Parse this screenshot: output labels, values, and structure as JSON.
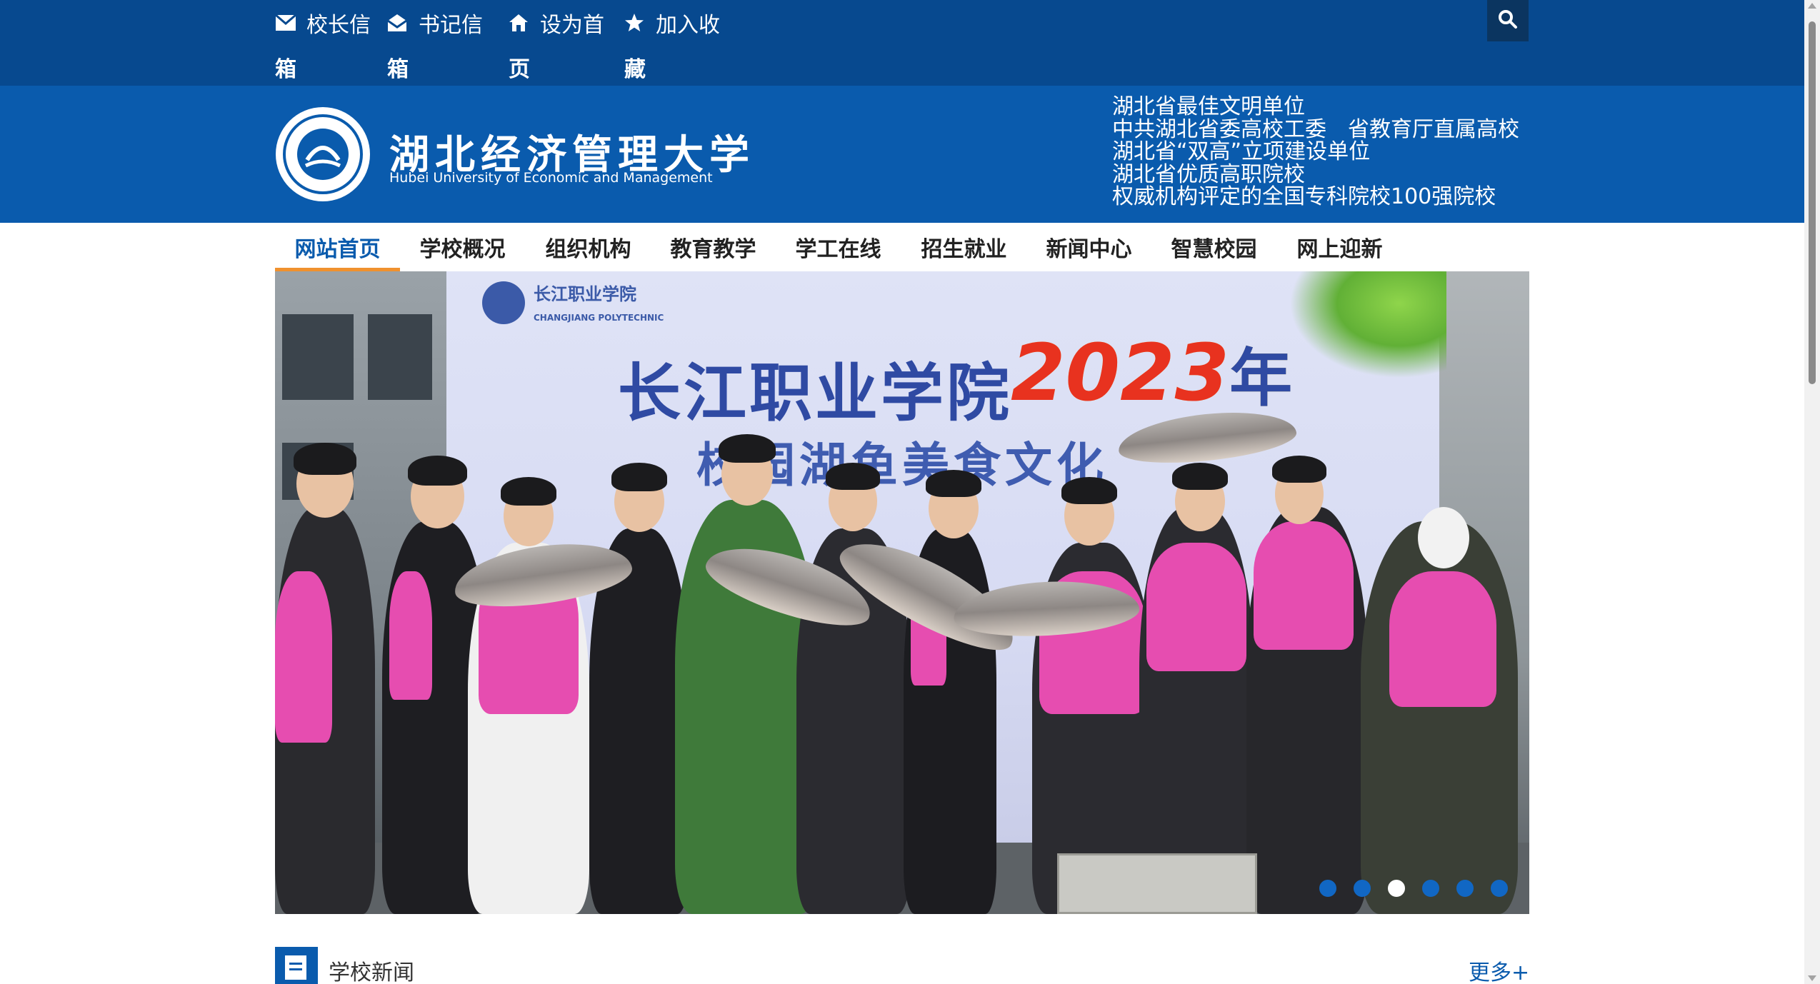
{
  "topbar": {
    "links": [
      {
        "label": "校长信",
        "wrap": "箱",
        "icon": "envelope-icon"
      },
      {
        "label": "书记信",
        "wrap": "箱",
        "icon": "open-envelope-icon"
      },
      {
        "label": "设为首",
        "wrap": "页",
        "icon": "home-icon"
      },
      {
        "label": "加入收",
        "wrap": "藏",
        "icon": "star-icon"
      }
    ],
    "search_icon": "search-icon"
  },
  "header": {
    "logo_cn": "湖北经济管理大学",
    "logo_en": "Hubei University of Economic and Management",
    "honors": [
      "湖北省最佳文明单位",
      "中共湖北省委高校工委　省教育厅直属高校",
      "湖北省“双高”立项建设单位",
      "湖北省优质高职院校",
      "权威机构评定的全国专科院校100强院校"
    ]
  },
  "nav": {
    "items": [
      "网站首页",
      "学校概况",
      "组织机构",
      "教育教学",
      "学工在线",
      "招生就业",
      "新闻中心",
      "智慧校园",
      "网上迎新"
    ],
    "active_index": 0
  },
  "banner": {
    "backdrop_logo": "长江职业学院",
    "backdrop_logo_en": "CHANGJIANG POLYTECHNIC",
    "backdrop_title": "长江职业学院",
    "backdrop_year": "2023",
    "backdrop_year_suffix": "年",
    "backdrop_subtitle": "校园湖鱼美食文化",
    "slide_count": 6,
    "active_slide": 2
  },
  "news": {
    "title": "学校新闻",
    "more": "更多+"
  },
  "colors": {
    "topbar": "#07498f",
    "header": "#0a5bad",
    "accent": "#f0912e"
  }
}
